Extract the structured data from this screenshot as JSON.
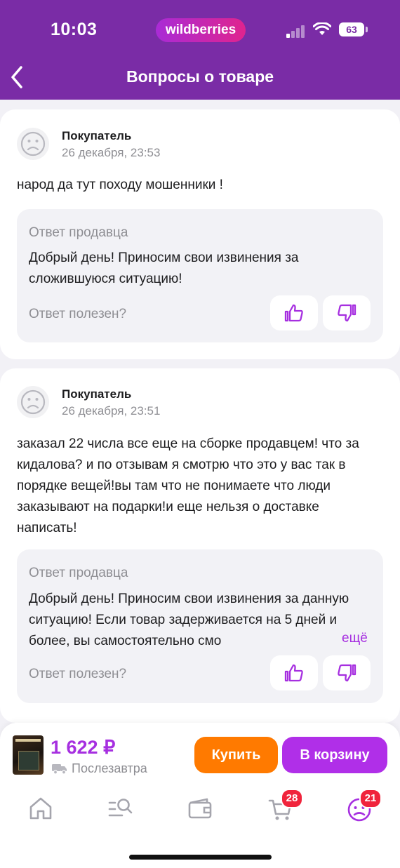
{
  "status_bar": {
    "time": "10:03",
    "brand": "wildberries",
    "battery": "63"
  },
  "header": {
    "title": "Вопросы о товаре"
  },
  "questions": [
    {
      "author": "Покупатель",
      "date": "26 декабря, 23:53",
      "text": "народ да тут походу мошенники !",
      "reply_label": "Ответ продавца",
      "reply_text": "Добрый день! Приносим свои извинения за сложившуюся ситуацию!",
      "useful_label": "Ответ полезен?"
    },
    {
      "author": "Покупатель",
      "date": "26 декабря, 23:51",
      "text": "заказал 22 числа все еще на сборке продавцем! что за кидалова? и по отзывам я смотрю что это у вас так в порядке вещей!вы там что не понимаете что люди заказывают на подарки!и еще нельзя о доставке написать!",
      "reply_label": "Ответ продавца",
      "reply_text": "Добрый день! Приносим свои извинения за данную ситуацию! Если товар задерживается на 5 дней и более, вы самостоятельно смо",
      "more_label": "ещё",
      "useful_label": "Ответ полезен?"
    }
  ],
  "purchase_bar": {
    "price": "1 622 ₽",
    "delivery": "Послезавтра",
    "buy_label": "Купить",
    "cart_label": "В корзину"
  },
  "tab_bar": {
    "cart_badge": "28",
    "profile_badge": "21"
  },
  "colors": {
    "header": "#7a2ca6",
    "accent": "#a62fe0",
    "buy": "#ff7a00",
    "cart": "#b02fe8",
    "badge": "#f0243c"
  }
}
